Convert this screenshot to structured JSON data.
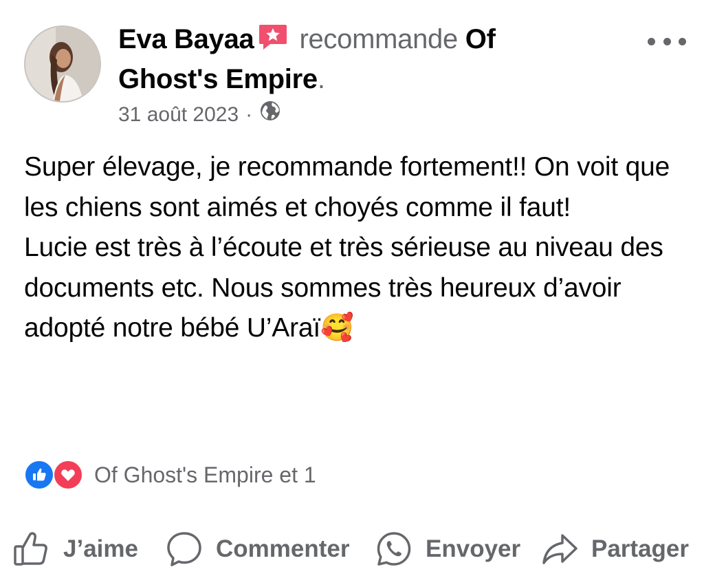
{
  "post": {
    "author": "Eva Bayaa",
    "action_verb": "recommande",
    "page_name": "Of Ghost's Empire",
    "trailing": ".",
    "date": "31 août 2023",
    "separator": "·",
    "audience_icon": "globe-icon",
    "body_lines": [
      "Super élevage, je recommande fortement!! On voit que les chiens sont aimés et choyés comme il faut!",
      "Lucie est très à l’écoute et très sérieuse au niveau des documents etc. Nous sommes très heureux d’avoir adopté notre bébé U’Araï🥰"
    ]
  },
  "reactions": {
    "icons": [
      "like-reaction-icon",
      "love-reaction-icon"
    ],
    "summary": "Of Ghost's Empire et 1"
  },
  "actions": {
    "like": "J’aime",
    "comment": "Commenter",
    "send": "Envoyer",
    "share": "Partager"
  },
  "colors": {
    "primary_text": "#050505",
    "secondary_text": "#65676b",
    "like_blue": "#1877f2",
    "love_red": "#f33e58",
    "recommend_badge": "#f0506e"
  }
}
